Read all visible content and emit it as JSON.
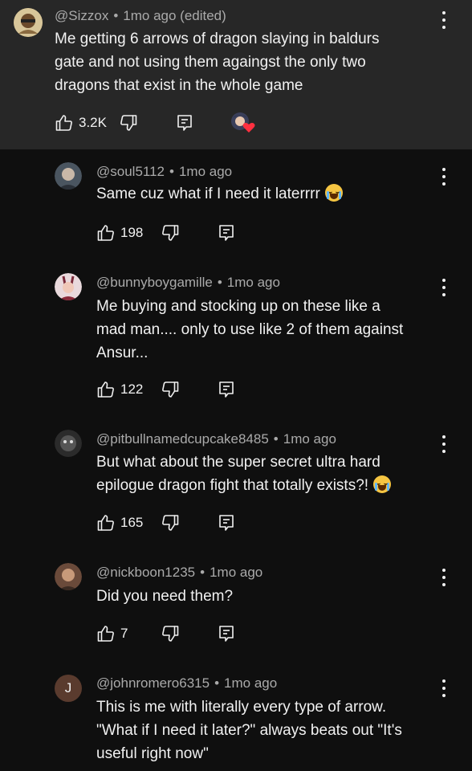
{
  "top_comment": {
    "handle": "@Sizzox",
    "time": "1mo ago (edited)",
    "lines": [
      "Me getting 6 arrows of dragon slaying in baldurs",
      "gate and not using them againgst the only two",
      "dragons that exist in the whole game"
    ],
    "likes": "3.2K",
    "creator_heart": true
  },
  "replies": [
    {
      "handle": "@soul5112",
      "time": "1mo ago",
      "lines": [
        "Same cuz what if I need it laterrrr"
      ],
      "emoji_after_line": 0,
      "likes": "198"
    },
    {
      "handle": "@bunnyboygamille",
      "time": "1mo ago",
      "lines": [
        "Me buying and stocking up on these like a",
        "mad man.... only to use like 2 of them against",
        "Ansur..."
      ],
      "likes": "122"
    },
    {
      "handle": "@pitbullnamedcupcake8485",
      "time": "1mo ago",
      "lines": [
        "But what about the super secret ultra hard",
        "epilogue dragon fight that totally exists?!"
      ],
      "emoji_after_line": 1,
      "likes": "165"
    },
    {
      "handle": "@nickboon1235",
      "time": "1mo ago",
      "lines": [
        "Did you need them?"
      ],
      "likes": "7"
    },
    {
      "handle": "@johnromero6315",
      "time": "1mo ago",
      "avatar_letter": "J",
      "lines": [
        "This is me with literally every type of arrow.",
        "\"What if I need it later?\" always beats out \"It's",
        "useful right now\""
      ]
    }
  ],
  "colors": {
    "background": "#0f0f0f",
    "highlight": "#272727",
    "meta": "#aaaaaa",
    "text": "#f1f1f1",
    "heart": "#ff3040"
  },
  "icons": [
    "thumb-up-icon",
    "thumb-down-icon",
    "reply-icon",
    "more-vert-icon",
    "heart-icon",
    "loudly-crying-face-emoji"
  ]
}
